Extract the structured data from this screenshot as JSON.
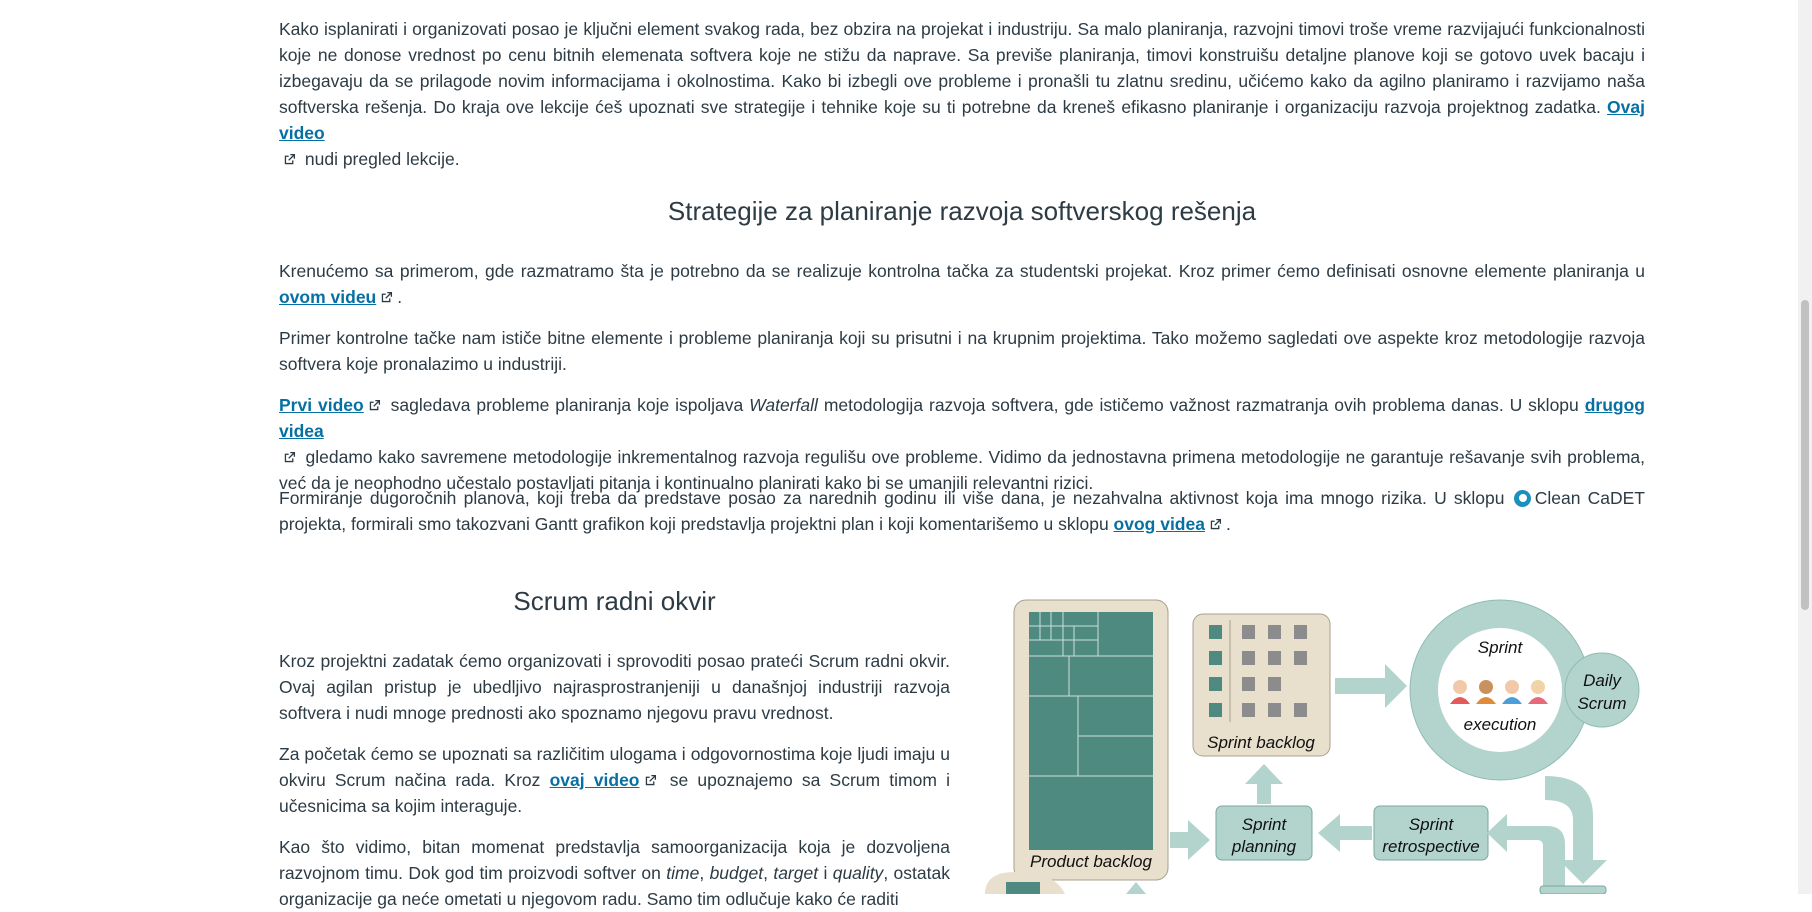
{
  "intro": {
    "text_before_link": "Kako isplanirati i organizovati posao je ključni element svakog rada, bez obzira na projekat i industriju. Sa malo planiranja, razvojni timovi troše vreme razvijajući funkcionalnosti koje ne donose vrednost po cenu bitnih elemenata softvera koje ne stižu da naprave. Sa previše planiranja, timovi konstruišu detaljne planove koji se gotovo uvek bacaju i izbegavaju da se prilagode novim informacijama i okolnostima. Kako bi izbegli ove probleme i pronašli tu zlatnu sredinu, učićemo kako da agilno planiramo i razvijamo naša softverska rešenja. Do kraja ove lekcije ćeš upoznati sve strategije i tehnike koje su ti potrebne da kreneš efikasno planiranje i organizaciju razvoja projektnog zadatka. ",
    "link": "Ovaj video",
    "text_after_link": "nudi pregled lekcije."
  },
  "section1": {
    "heading": "Strategije za planiranje razvoja softverskog rešenja",
    "p1_text": "Krenućemo sa primerom, gde razmatramo šta je potrebno da se realizuje kontrolna tačka za studentski projekat. Kroz primer ćemo definisati osnovne elemente planiranja u ",
    "p1_link": "ovom videu",
    "p1_end": ".",
    "p2_text": "Primer kontrolne tačke nam ističe bitne elemente  i probleme planiranja koji su prisutni i na krupnim projektima. Tako možemo sagledati ove aspekte kroz metodologije razvoja softvera koje pronalazimo u industriji.",
    "p3_link1": "Prvi video",
    "p3_text1": "sagledava probleme planiranja koje ispoljava ",
    "p3_em": "Waterfall",
    "p3_text2": " metodologija razvoja softvera, gde ističemo važnost razmatranja ovih problema danas. U sklopu ",
    "p3_link2": "drugog videa",
    "p3_text3": "gledamo kako savremene metodologije inkrementalnog razvoja regulišu ove probleme. Vidimo da jednostavna primena metodologije ne garantuje rešavanje svih problema, već da je neophodno učestalo postavljati pitanja i kontinualno planirati kako bi se umanjili relevantni rizici.",
    "p4_text1": "Formiranje dugoročnih planova, koji treba da predstave posao za narednih godinu ili više dana, je nezahvalna aktivnost koja ima mnogo rizika. U sklopu ",
    "p4_text2": "Clean CaDET projekta, formirali smo takozvani Gantt grafikon koji predstavlja projektni plan i koji komentarišemo u sklopu ",
    "p4_link": "ovog videa",
    "p4_end": "."
  },
  "section2": {
    "heading": "Scrum radni okvir",
    "p1": "Kroz projektni zadatak ćemo organizovati i sprovoditi posao prateći Scrum radni okvir. Ovaj agilan pristup je ubedljivo najrasprostranjeniji u današnjoj industriji razvoja softvera i nudi mnoge prednosti ako spoznamo njegovu pravu vrednost.",
    "p2_text1": "Za početak ćemo se upoznati sa različitim ulogama i odgovornostima koje ljudi imaju u okviru Scrum načina rada. Kroz ",
    "p2_link": "ovaj video",
    "p2_text2": "se upoznajemo sa Scrum timom i učesnicima sa kojim interaguje.",
    "p3_text1": "Kao što vidimo, bitan momenat predstavlja samoorganizacija koja je dozvoljena razvojnom timu. Dok god tim proizvodi softver on ",
    "p3_em1": "time",
    "p3_sep1": ", ",
    "p3_em2": "budget",
    "p3_sep2": ", ",
    "p3_em3": "target",
    "p3_sep3": " i ",
    "p3_em4": "quality",
    "p3_text2": ", ostatak",
    "p3_line3": "organizacije ga neće ometati u njegovom radu. Samo tim odlučuje kako će raditi"
  },
  "diagram": {
    "product_backlog": "Product backlog",
    "sprint_backlog": "Sprint backlog",
    "sprint": "Sprint",
    "execution": "execution",
    "daily_scrum_1": "Daily",
    "daily_scrum_2": "Scrum",
    "sprint_planning_1": "Sprint",
    "sprint_planning_2": "planning",
    "sprint_retro_1": "Sprint",
    "sprint_retro_2": "retrospective",
    "colors": {
      "teal": "#4e8a7f",
      "light_teal": "#b3d4cd",
      "beige": "#e9dfcd"
    }
  },
  "colors": {
    "link": "#0770a3",
    "text": "#2d3b45"
  }
}
